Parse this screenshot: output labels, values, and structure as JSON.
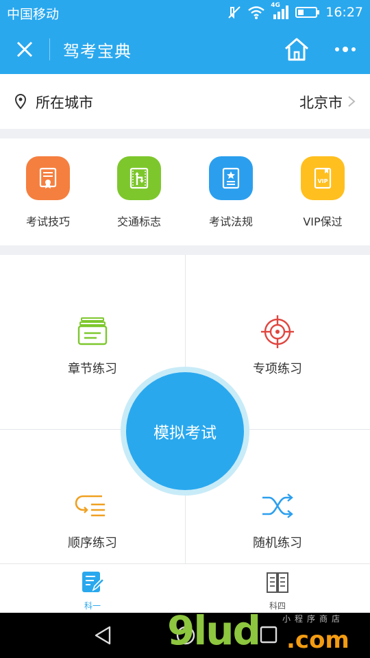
{
  "status_bar": {
    "carrier": "中国移动",
    "network": "4G",
    "time": "16:27",
    "icons": [
      "mute-icon",
      "wifi-icon",
      "signal-icon",
      "battery-icon"
    ]
  },
  "app_bar": {
    "title": "驾考宝典",
    "icons": [
      "close-icon",
      "home-icon",
      "more-icon"
    ]
  },
  "city": {
    "label": "所在城市",
    "value": "北京市"
  },
  "quick_links": [
    {
      "label": "考试技巧",
      "color": "#f57f3f",
      "icon": "certificate-icon"
    },
    {
      "label": "交通标志",
      "color": "#7dc72d",
      "icon": "traffic-sign-icon"
    },
    {
      "label": "考试法规",
      "color": "#2b9fee",
      "icon": "rulebook-icon"
    },
    {
      "label": "VIP保过",
      "color": "#ffbf1f",
      "icon": "vip-icon"
    }
  ],
  "practice": {
    "chapter": "章节练习",
    "special": "专项练习",
    "sequential": "顺序练习",
    "random": "随机练习",
    "mock_exam": "模拟考试"
  },
  "tabs": [
    {
      "label": "科一",
      "active": true,
      "icon": "pencil-note-icon"
    },
    {
      "label": "科四",
      "active": false,
      "icon": "book-icon"
    }
  ],
  "watermark": {
    "main": "9lud",
    "domain": ".com",
    "sub": "小程序商店"
  },
  "colors": {
    "primary": "#29a8ee",
    "chapter_icon": "#7dc72d",
    "special_icon": "#e0463f",
    "sequential_icon": "#f0a020",
    "random_icon": "#2b9fee"
  }
}
